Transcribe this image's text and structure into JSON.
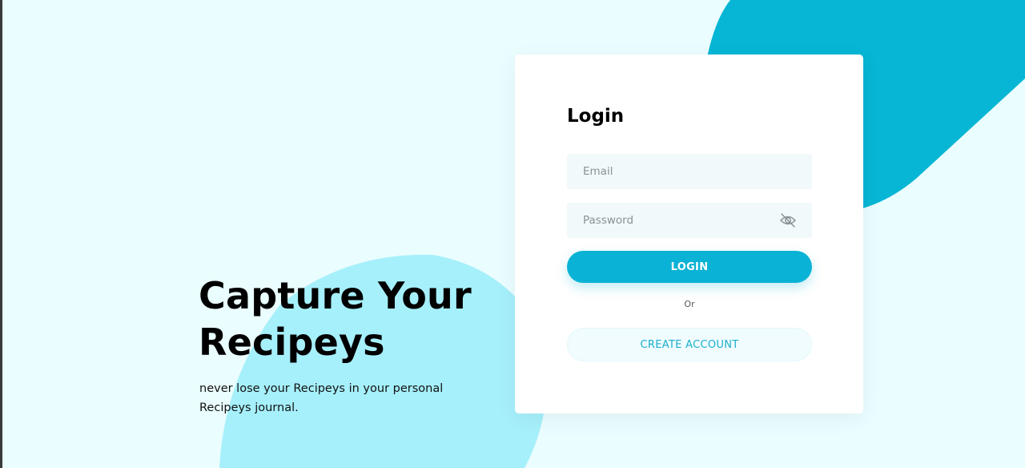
{
  "hero": {
    "title": "Capture Your Recipeys",
    "subtitle": "never lose your Recipeys in your personal Recipeys journal."
  },
  "login": {
    "title": "Login",
    "email": {
      "placeholder": "Email",
      "value": ""
    },
    "password": {
      "placeholder": "Password",
      "value": ""
    },
    "toggle_visibility_icon": "eye-slash-icon",
    "login_button": "LOGIN",
    "divider": "Or",
    "create_account_button": "CREATE ACCOUNT"
  },
  "colors": {
    "background": "#eafdff",
    "accent": "#0ab3d5",
    "blob_light": "#a6f0fb",
    "blob_dark": "#07b6d4",
    "field_bg": "#f1f9fb",
    "card": "#ffffff"
  }
}
